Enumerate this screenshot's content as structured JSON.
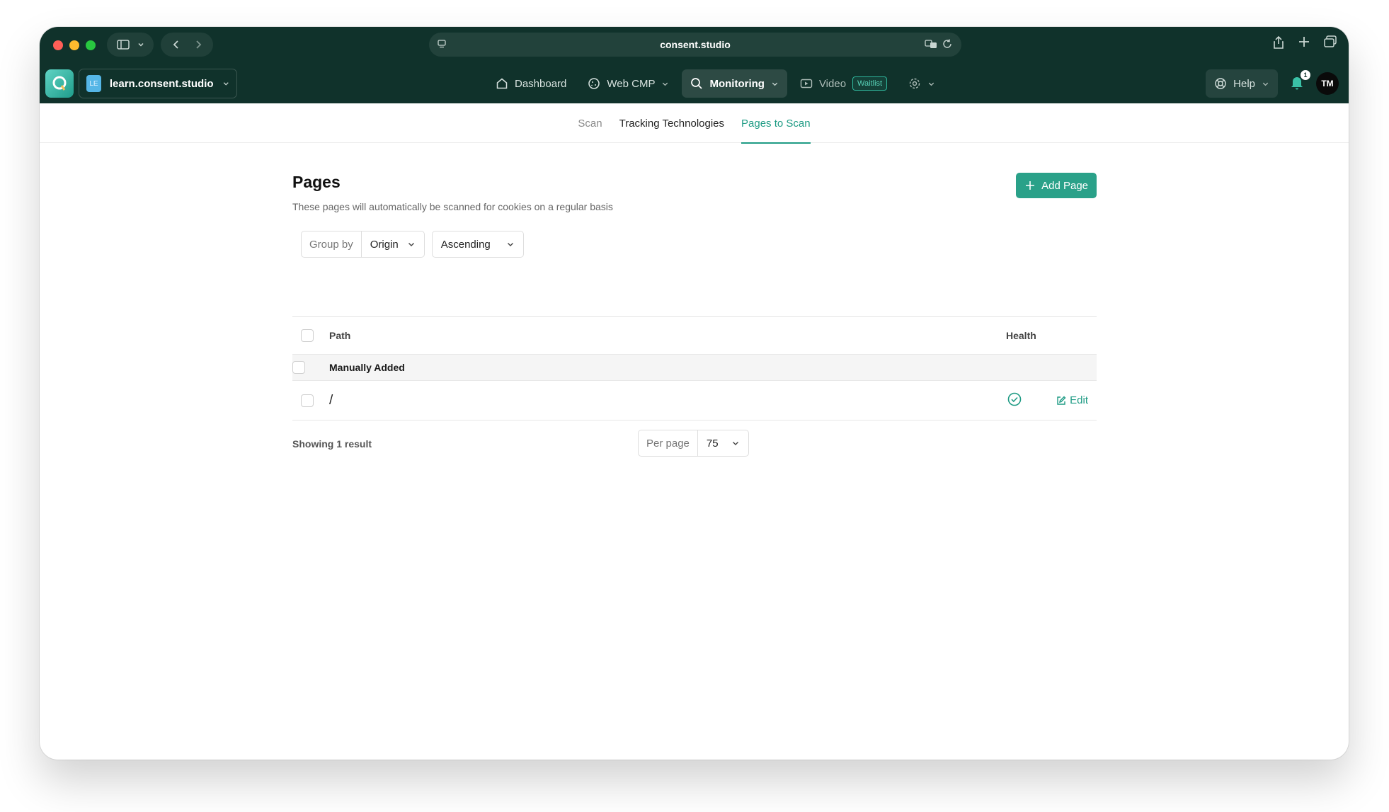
{
  "browser": {
    "url": "consent.studio"
  },
  "app": {
    "workspace_badge": "LE",
    "workspace_name": "learn.consent.studio",
    "nav": {
      "dashboard": "Dashboard",
      "web_cmp": "Web CMP",
      "monitoring": "Monitoring",
      "video": "Video",
      "waitlist": "Waitlist"
    },
    "help": "Help",
    "notification_count": "1",
    "avatar_initials": "TM"
  },
  "tabs": {
    "scan": "Scan",
    "tracking": "Tracking Technologies",
    "pages": "Pages to Scan"
  },
  "page": {
    "title": "Pages",
    "subtitle": "These pages will automatically be scanned for cookies on a regular basis",
    "add_button": "Add Page"
  },
  "filters": {
    "group_by_label": "Group by",
    "group_by_value": "Origin",
    "sort_value": "Ascending"
  },
  "table": {
    "columns": {
      "path": "Path",
      "health": "Health"
    },
    "group_label": "Manually Added",
    "rows": [
      {
        "path": "/",
        "health": "ok",
        "action": "Edit"
      }
    ]
  },
  "footer": {
    "showing": "Showing 1 result",
    "per_page_label": "Per page",
    "per_page_value": "75"
  },
  "colors": {
    "accent": "#2aa189",
    "nav_bg": "#10322b"
  }
}
